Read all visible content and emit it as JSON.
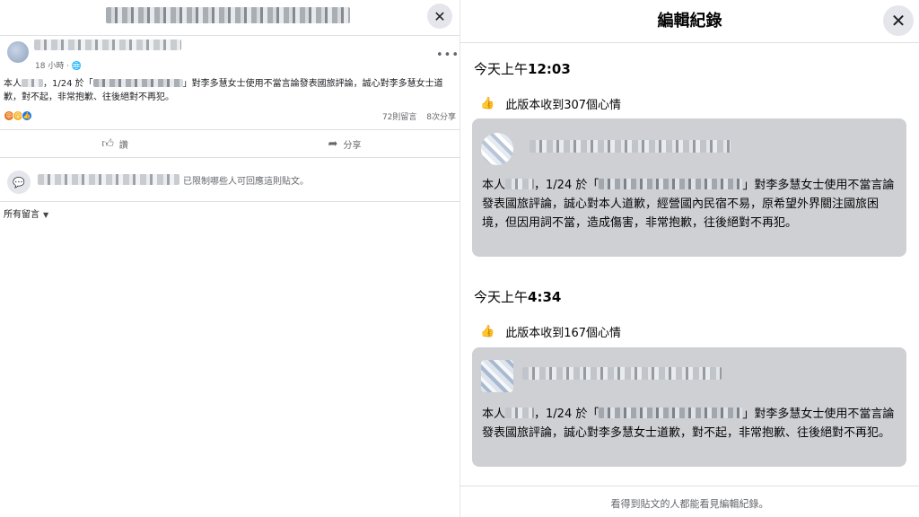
{
  "left": {
    "post": {
      "time": "18 小時 · 🌐",
      "more_label": "•••",
      "text_prefix": "本人",
      "text_mid": "，1/24 於「",
      "text_rest": "」對李多慧女士使用不當言論發表國旅評論，誠心對李多慧女士道歉，對不起，非常抱歉、往後絕對不再犯。",
      "stats": {
        "comments": "72則留言",
        "shares": "8次分享"
      },
      "actions": {
        "like": "讚",
        "share": "分享"
      }
    },
    "restricted_text": "已限制哪些人可回應這則貼文。",
    "all_comments": "所有留言"
  },
  "right": {
    "title": "編輯紀錄",
    "versions": [
      {
        "time_prefix": "今天上午",
        "time_bold": "12:03",
        "reactions": "此版本收到307個心情",
        "text_prefix": "本人",
        "text_mid": "，1/24 於「",
        "text_rest": "」對李多慧女士使用不當言論發表國旅評論，誠心對本人道歉，經營國內民宿不易，原希望外界關注國旅困境，但因用詞不當，造成傷害，非常抱歉，往後絕對不再犯。"
      },
      {
        "time_prefix": "今天上午",
        "time_bold": "4:34",
        "reactions": "此版本收到167個心情",
        "text_prefix": "本人",
        "text_mid": "，1/24 於「",
        "text_rest": "」對李多慧女士使用不當言論發表國旅評論，誠心對李多慧女士道歉，對不起，非常抱歉、往後絕對不再犯。"
      }
    ],
    "footer": "看得到貼文的人都能看見編輯紀錄。"
  },
  "icons": {
    "close": "close-icon",
    "like": "thumb-up-icon",
    "share": "share-arrow-icon",
    "globe": "globe-icon",
    "comment_restricted": "speech-bubble-icon"
  },
  "colors": {
    "brand_blue": "#1877f2",
    "card_bg": "#ced0d4",
    "muted_text": "#65676b"
  }
}
